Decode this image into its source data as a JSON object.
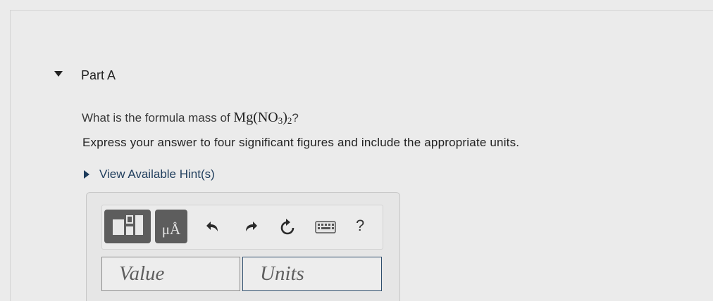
{
  "part": {
    "title": "Part A"
  },
  "question": {
    "prefix": "What is the formula mass of ",
    "formula_main": "Mg(NO",
    "formula_sub1": "3",
    "formula_close": ")",
    "formula_sub2": "2",
    "suffix": "?"
  },
  "instruction": "Express your answer to four significant figures and include the appropriate units.",
  "hints": {
    "label": "View Available Hint(s)"
  },
  "toolbar": {
    "units_symbol": "μÅ",
    "help_label": "?",
    "icons": [
      "templates-icon",
      "units-icon",
      "undo-icon",
      "redo-icon",
      "reset-icon",
      "keyboard-icon",
      "help-icon"
    ]
  },
  "answer": {
    "value_placeholder": "Value",
    "units_placeholder": "Units",
    "value": "",
    "units": ""
  },
  "colors": {
    "background": "#ebebeb",
    "tool_button": "#5d5d5d",
    "hint_link": "#1f3d5c",
    "units_border": "#2f4f6e"
  }
}
